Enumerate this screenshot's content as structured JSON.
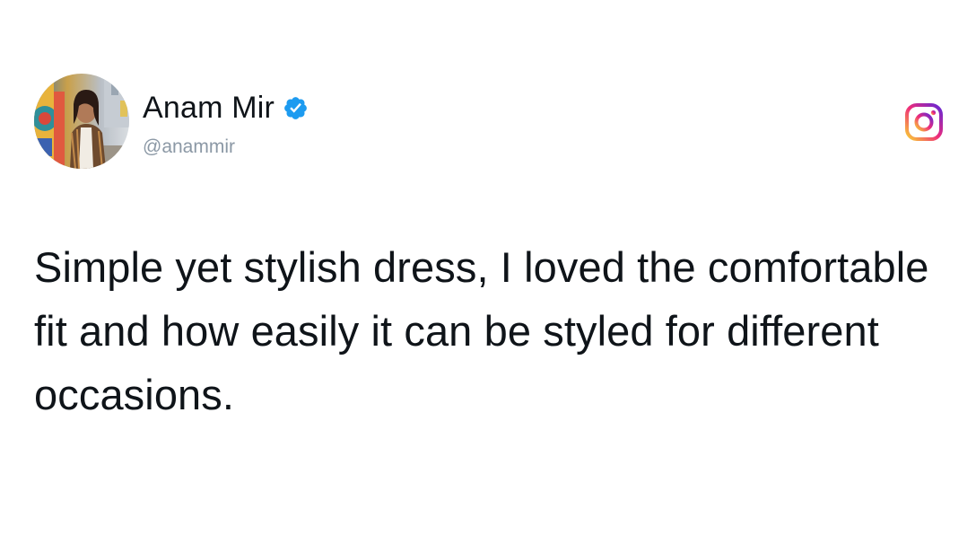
{
  "post": {
    "author": {
      "display_name": "Anam Mir",
      "handle": "@anammir",
      "verified": true,
      "verified_icon": "verified-badge-icon",
      "verified_color": "#1d9bf0"
    },
    "platform_icon": "instagram-icon",
    "platform_colors": [
      "#f9ce34",
      "#ee2a7b",
      "#6228d7"
    ],
    "text": "Simple yet stylish dress, I loved the comfortable fit and how easily it can be styled for different occasions."
  }
}
